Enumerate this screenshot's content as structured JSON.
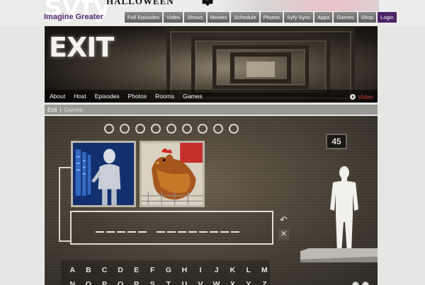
{
  "site": {
    "logo": "syfy",
    "tagline": "Imagine Greater",
    "promo": "HALLOWEEN"
  },
  "nav": {
    "items": [
      "Full Episodes",
      "Video",
      "Shows",
      "Movies",
      "Schedule",
      "Photos",
      "Syfy Sync",
      "Apps",
      "Games",
      "Shop"
    ],
    "login": "Login"
  },
  "hero": {
    "title": "EXIT",
    "subnav": [
      "About",
      "Host",
      "Episodes",
      "Photos",
      "Rooms",
      "Games"
    ],
    "video_label": "Video"
  },
  "breadcrumb": {
    "root": "Exit",
    "separator": "|",
    "current": "Games"
  },
  "game": {
    "counter": "45",
    "progress_circles": 9,
    "answer_word_lengths": [
      5,
      8
    ],
    "keyboard_row1": [
      "A",
      "B",
      "C",
      "D",
      "E",
      "F",
      "G",
      "H",
      "I",
      "J",
      "K",
      "L",
      "M"
    ],
    "keyboard_row2": [
      "N",
      "O",
      "P",
      "Q",
      "R",
      "S",
      "T",
      "U",
      "V",
      "W",
      "X",
      "Y",
      "Z"
    ],
    "undo_icon": "undo-arrow",
    "clear_icon": "x-mark",
    "images": [
      "robot-woman-server",
      "rooster-in-cage"
    ]
  },
  "colors": {
    "brand_purple": "#5b2d7a",
    "login_bg": "#4b2368",
    "video_accent": "#cc4444"
  }
}
